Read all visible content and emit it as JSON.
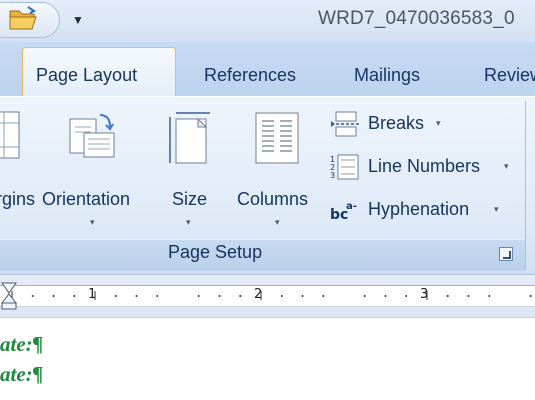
{
  "title_bar": {
    "window_title": "WRD7_0470036583_0",
    "qat": {
      "open_icon": "folder-open-icon",
      "more_icon": "customize-qat-arrow-icon"
    }
  },
  "tabs": [
    {
      "label": "Page Layout",
      "active": true
    },
    {
      "label": "References",
      "active": false
    },
    {
      "label": "Mailings",
      "active": false
    },
    {
      "label": "Review",
      "active": false
    }
  ],
  "ribbon": {
    "group_label": "Page Setup",
    "dialog_launcher_icon": "dialog-launcher-icon",
    "large_buttons": [
      {
        "label": "rgins",
        "icon": "margins-icon"
      },
      {
        "label": "Orientation",
        "icon": "orientation-icon"
      },
      {
        "label": "Size",
        "icon": "size-icon"
      },
      {
        "label": "Columns",
        "icon": "columns-icon"
      }
    ],
    "small_buttons": [
      {
        "label": "Breaks",
        "icon": "breaks-icon"
      },
      {
        "label": "Line Numbers",
        "icon": "line-numbers-icon"
      },
      {
        "label": "Hyphenation",
        "icon": "hyphenation-icon"
      }
    ],
    "dropdown_glyph": "▾"
  },
  "ruler": {
    "numbers": [
      "1",
      "2",
      "3"
    ]
  },
  "document": {
    "lines": [
      "ate:¶",
      "ate:¶"
    ]
  },
  "colors": {
    "ribbon_bg": "#dfeaf7",
    "tab_text": "#15345f",
    "active_tab_border": "#f0b95c",
    "doc_text": "#1e8a3c"
  }
}
